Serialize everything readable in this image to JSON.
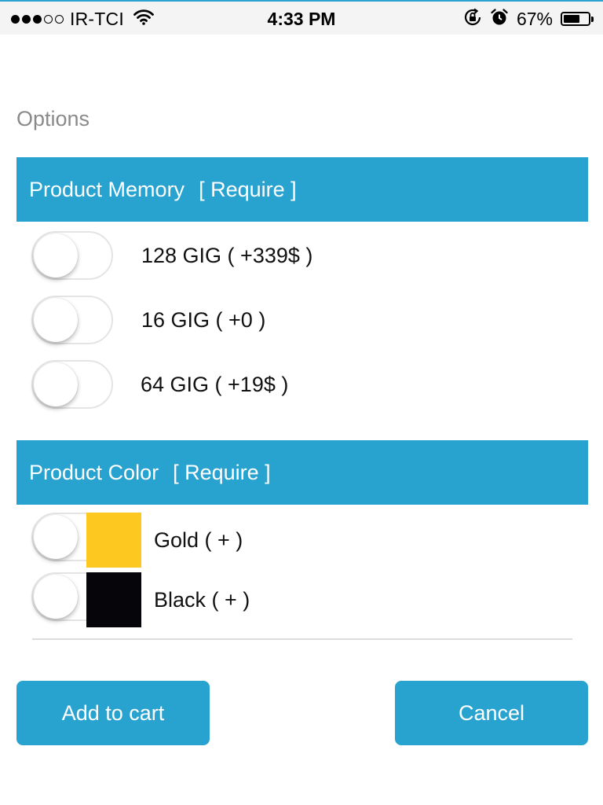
{
  "status_bar": {
    "carrier": "IR-TCI",
    "time": "4:33 PM",
    "battery_percent_label": "67%",
    "battery_level": 0.67,
    "signal_bars_filled": 3,
    "signal_bars_total": 5
  },
  "options_label": "Options",
  "memory_section": {
    "title": "Product Memory",
    "require": "[ Require ]",
    "options": [
      {
        "label": "128 GIG ( +339$ )",
        "selected": false
      },
      {
        "label": "16 GIG ( +0 )",
        "selected": false
      },
      {
        "label": "64 GIG ( +19$ )",
        "selected": false
      }
    ]
  },
  "color_section": {
    "title": "Product Color",
    "require": "[ Require ]",
    "options": [
      {
        "label": "Gold ( + )",
        "swatch": "#fdc921",
        "selected": false
      },
      {
        "label": "Black ( + )",
        "swatch": "#06060a",
        "selected": false
      }
    ]
  },
  "actions": {
    "add_to_cart": "Add to cart",
    "cancel": "Cancel"
  },
  "colors": {
    "accent": "#28a3d0",
    "muted_text": "#8a8a8a"
  }
}
